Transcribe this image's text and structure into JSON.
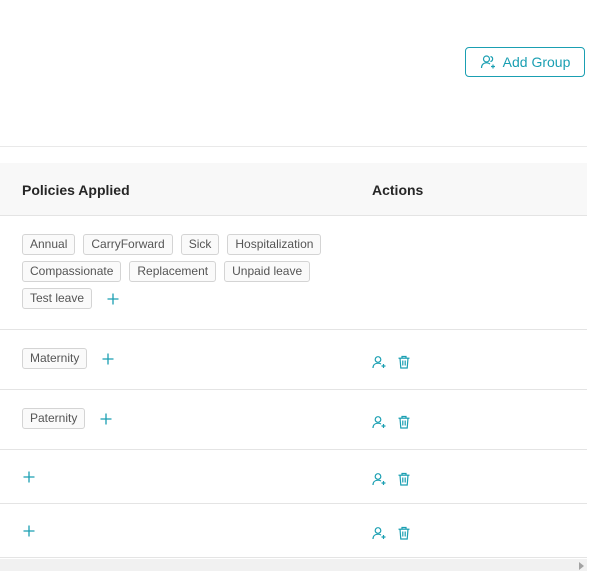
{
  "header": {
    "add_group_label": "Add Group"
  },
  "table": {
    "columns": {
      "policies": "Policies Applied",
      "actions": "Actions"
    },
    "rows": [
      {
        "tags": [
          "Annual",
          "CarryForward",
          "Sick",
          "Hospitalization",
          "Compassionate",
          "Replacement",
          "Unpaid leave",
          "Test leave"
        ],
        "has_actions": false
      },
      {
        "tags": [
          "Maternity"
        ],
        "has_actions": true
      },
      {
        "tags": [
          "Paternity"
        ],
        "has_actions": true
      },
      {
        "tags": [],
        "has_actions": true
      },
      {
        "tags": [],
        "has_actions": true
      }
    ]
  },
  "icons": {
    "add_group": "user-group-icon",
    "add_policy": "plus-icon",
    "assign_user": "add-user-icon",
    "delete": "trash-icon"
  },
  "colors": {
    "accent": "#1a9fb2",
    "header_bg": "#f8f8f8",
    "border": "#e4e4e4",
    "tag_border": "#d4d4d4"
  }
}
